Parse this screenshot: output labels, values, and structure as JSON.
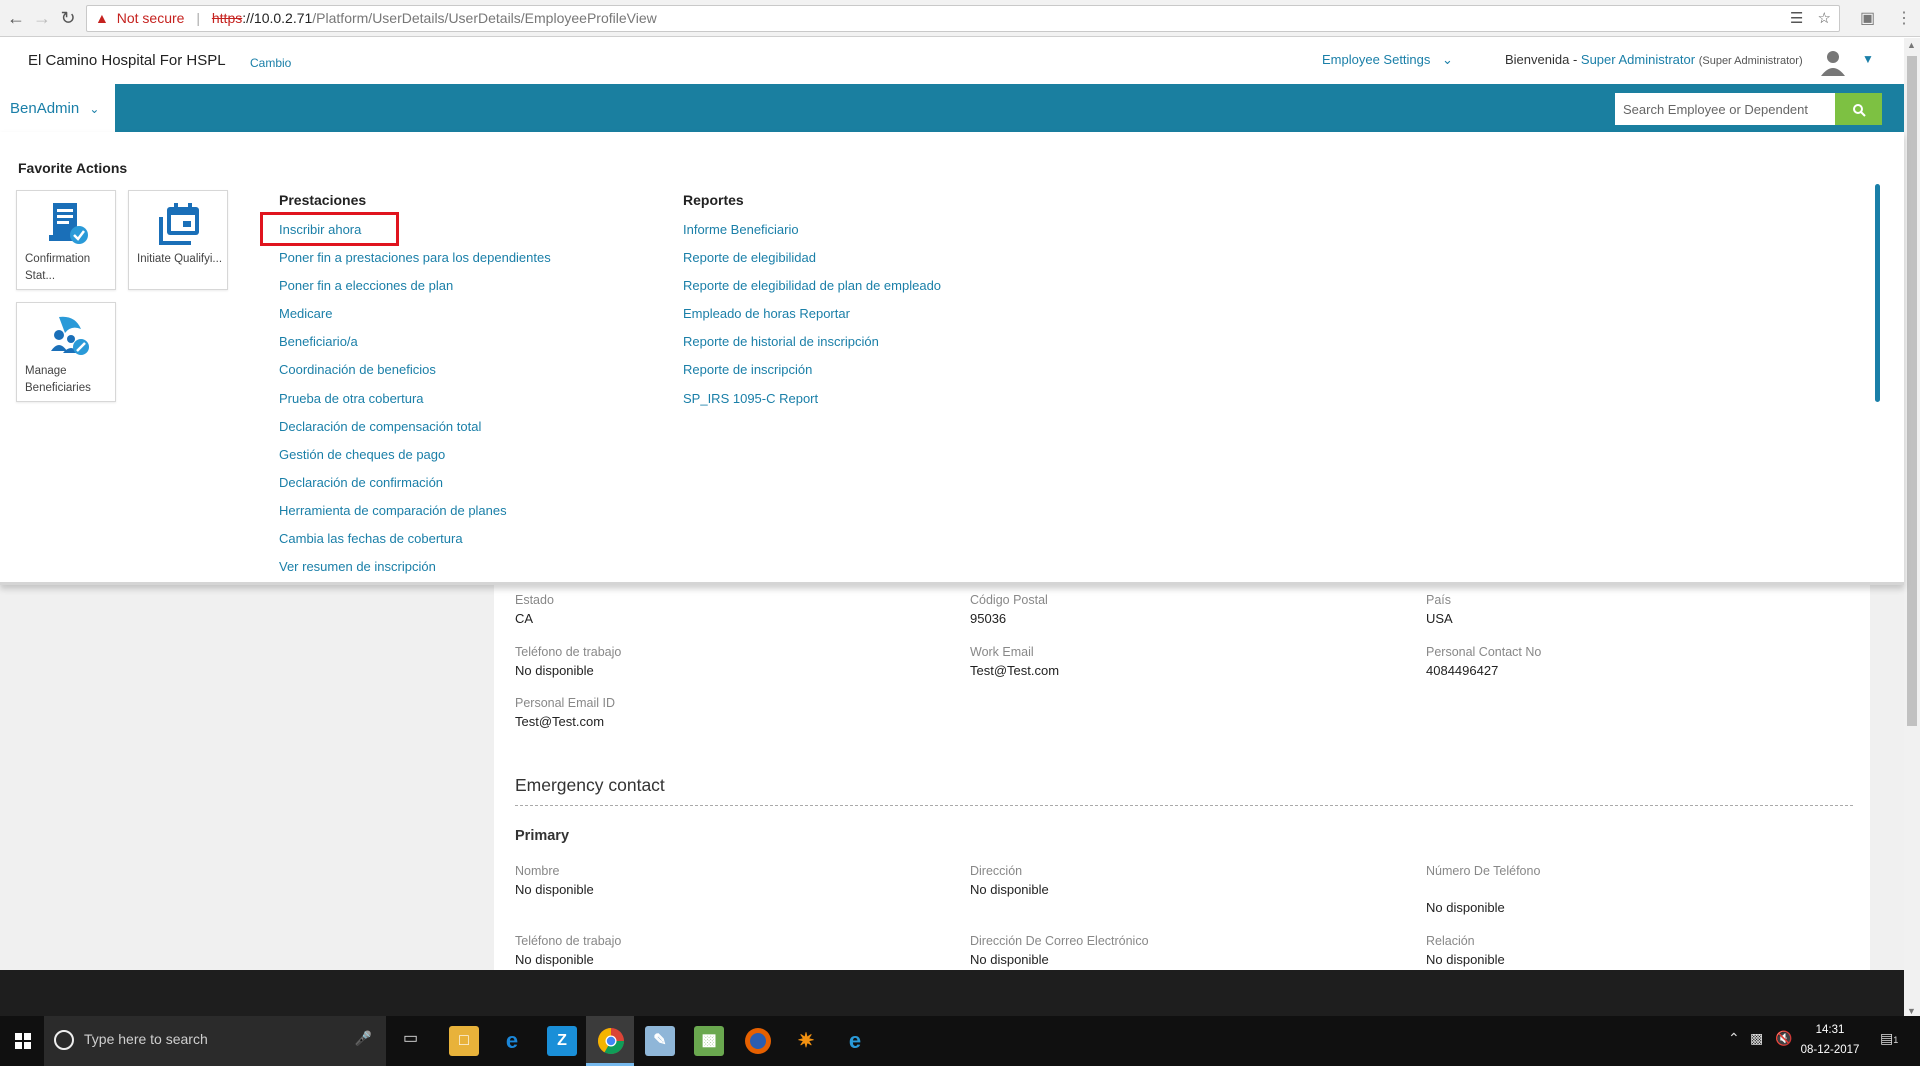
{
  "browser": {
    "not_secure": "Not secure",
    "url_scheme": "https",
    "url_host": "://10.0.2.71",
    "url_path": "/Platform/UserDetails/UserDetails/EmployeeProfileView"
  },
  "header": {
    "org_name": "El Camino Hospital For HSPL",
    "change_link": "Cambio",
    "employee_settings": "Employee Settings",
    "welcome": "Bienvenida -",
    "user_name": "Super Administrator",
    "user_role": "(Super Administrator)"
  },
  "navbar": {
    "module": "BenAdmin",
    "search_placeholder": "Search Employee or Dependent"
  },
  "menu": {
    "favorites_title": "Favorite Actions",
    "favorites": [
      {
        "label": "Confirmation Stat..."
      },
      {
        "label": "Initiate Qualifyi..."
      },
      {
        "label": "Manage Beneficiaries"
      }
    ],
    "prestaciones": {
      "title": "Prestaciones",
      "items": [
        "Inscribir ahora",
        "Poner fin a prestaciones para los dependientes",
        "Poner fin a elecciones de plan",
        "Medicare",
        "Beneficiario/a",
        "Coordinación de beneficios",
        "Prueba de otra cobertura",
        "Declaración de compensación total",
        "Gestión de cheques de pago",
        "Declaración de confirmación",
        "Herramienta de comparación de planes",
        "Cambia las fechas de cobertura",
        "Ver resumen de inscripción"
      ]
    },
    "reportes": {
      "title": "Reportes",
      "items": [
        "Informe Beneficiario",
        "Reporte de elegibilidad",
        "Reporte de elegibilidad de plan de empleado",
        "Empleado de horas Reportar",
        "Reporte de historial de inscripción",
        "Reporte de inscripción",
        "SP_IRS 1095-C Report"
      ]
    }
  },
  "profile": {
    "estado_label": "Estado",
    "estado_value": "CA",
    "postal_label": "Código Postal",
    "postal_value": "95036",
    "pais_label": "País",
    "pais_value": "USA",
    "work_phone_label": "Teléfono de trabajo",
    "work_phone_value": "No disponible",
    "work_email_label": "Work Email",
    "work_email_value": "Test@Test.com",
    "personal_contact_label": "Personal Contact No",
    "personal_contact_value": "4084496427",
    "personal_email_label": "Personal Email ID",
    "personal_email_value": "Test@Test.com"
  },
  "emergency": {
    "title": "Emergency contact",
    "primary_title": "Primary",
    "nombre_label": "Nombre",
    "nombre_value": "No disponible",
    "direccion_label": "Dirección",
    "direccion_value": "No disponible",
    "telefono_label": "Número De Teléfono",
    "telefono_value": "No disponible",
    "work_phone_label": "Teléfono de trabajo",
    "work_phone_value": "No disponible",
    "email_label": "Dirección De Correo Electrónico",
    "email_value": "No disponible",
    "relacion_label": "Relación",
    "relacion_value": "No disponible"
  },
  "taskbar": {
    "search_text": "Type here to search",
    "time": "14:31",
    "date": "08-12-2017",
    "notification_count": "1"
  },
  "colors": {
    "teal": "#1a7fa0",
    "link": "#1a7fa8",
    "search_button": "#7dc142",
    "highlight": "#e0141e"
  }
}
